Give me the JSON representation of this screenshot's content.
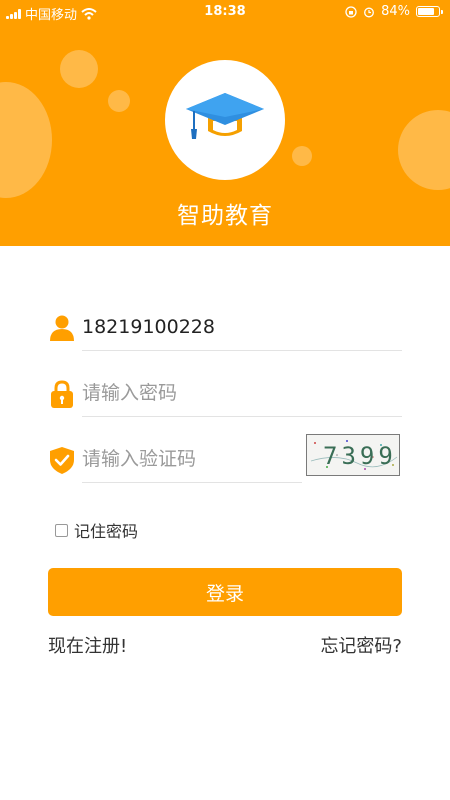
{
  "status_bar": {
    "carrier": "中国移动",
    "time": "18:38",
    "battery": "84%",
    "battery_level": 0.84
  },
  "app": {
    "name": "智助教育",
    "brand_color": "#ff9f00",
    "logo_icon": "graduation-cap-icon"
  },
  "form": {
    "phone": {
      "value": "18219100228",
      "icon": "user-icon"
    },
    "password": {
      "placeholder": "请输入密码",
      "icon": "lock-icon"
    },
    "captcha": {
      "placeholder": "请输入验证码",
      "icon": "shield-check-icon",
      "code": "7399"
    },
    "remember_label": "记住密码",
    "remember_checked": false,
    "login_label": "登录"
  },
  "links": {
    "register": "现在注册!",
    "forgot": "忘记密码?"
  }
}
